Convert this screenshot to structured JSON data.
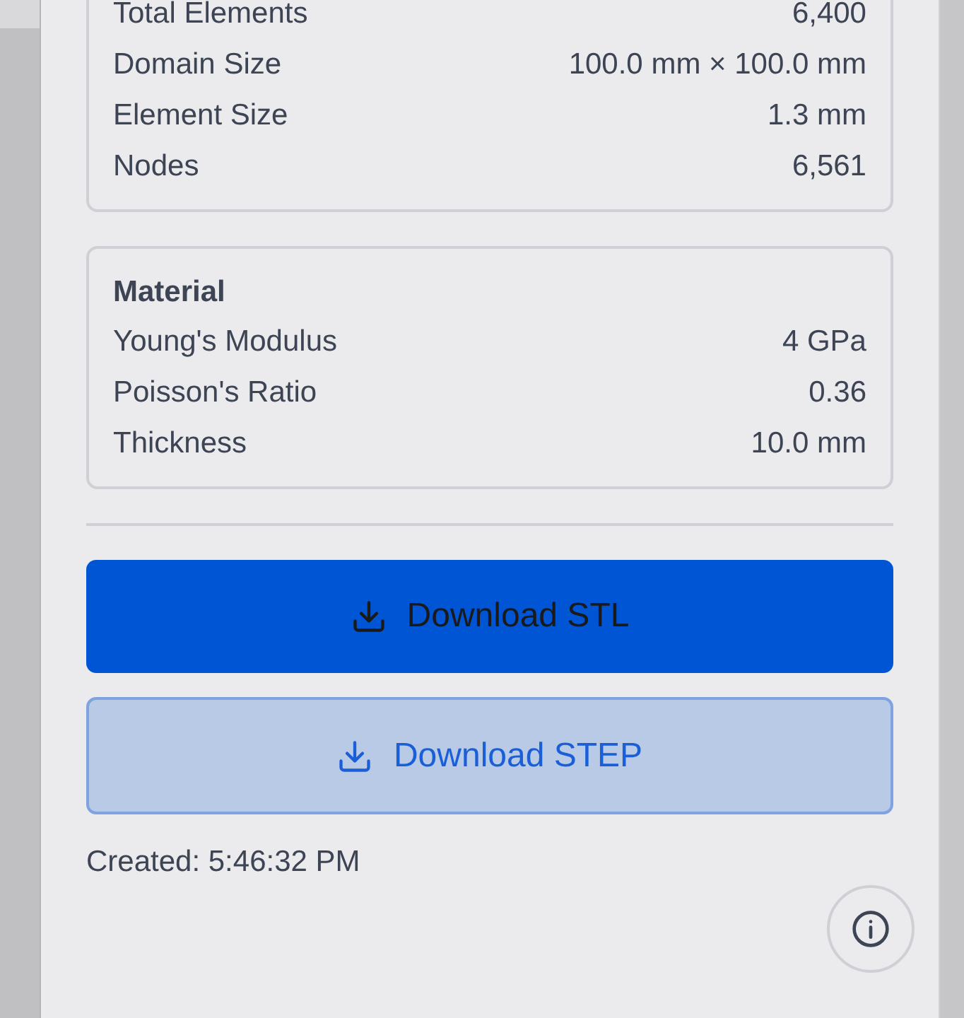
{
  "mesh_card": {
    "rows": [
      {
        "label": "Total Elements",
        "value": "6,400"
      },
      {
        "label": "Domain Size",
        "value": "100.0 mm × 100.0 mm"
      },
      {
        "label": "Element Size",
        "value": "1.3 mm"
      },
      {
        "label": "Nodes",
        "value": "6,561"
      }
    ]
  },
  "material_card": {
    "title": "Material",
    "rows": [
      {
        "label": "Young's Modulus",
        "value": "4 GPa"
      },
      {
        "label": "Poisson's Ratio",
        "value": "0.36"
      },
      {
        "label": "Thickness",
        "value": "10.0 mm"
      }
    ]
  },
  "buttons": [
    {
      "label": "Download STL",
      "kind": "primary"
    },
    {
      "label": "Download STEP",
      "kind": "secondary"
    }
  ],
  "created": "Created: 5:46:32 PM"
}
